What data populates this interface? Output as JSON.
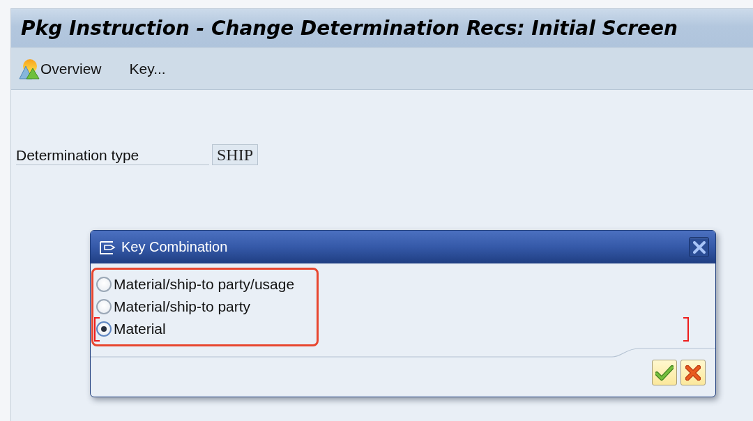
{
  "window": {
    "title": "Pkg Instruction - Change Determination Recs: Initial Screen"
  },
  "toolbar": [
    {
      "kind": "icon-button",
      "label": "Overview"
    },
    {
      "kind": "text-button",
      "label": "Key..."
    }
  ],
  "fields": [
    {
      "label": "Determination type",
      "value": "SHIP"
    }
  ],
  "dialog": {
    "title": "Key Combination",
    "options": [
      {
        "label": "Material/ship-to party/usage",
        "selected": false,
        "focused": false
      },
      {
        "label": "Material/ship-to party",
        "selected": false,
        "focused": false
      },
      {
        "label": "Material",
        "selected": true,
        "focused": true
      }
    ],
    "buttons": [
      {
        "kind": "confirm"
      },
      {
        "kind": "cancel"
      }
    ]
  }
}
